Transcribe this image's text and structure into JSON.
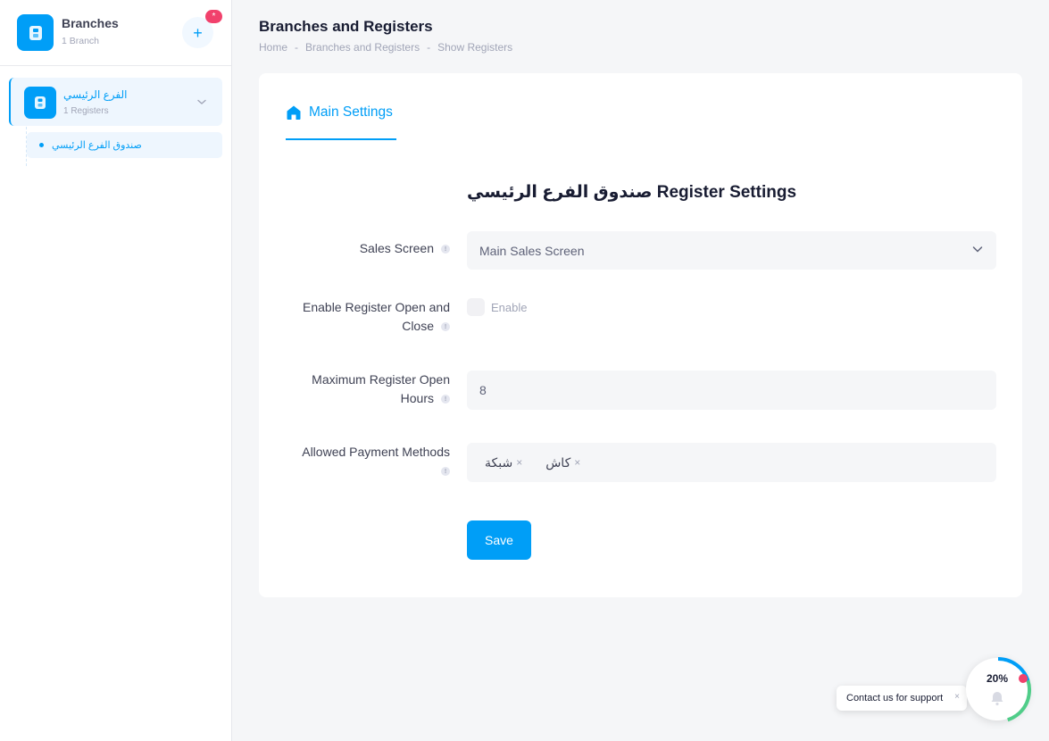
{
  "sidebar": {
    "title": "Branches",
    "subtitle": "1 Branch",
    "add_label": "+",
    "notif_badge": "*",
    "branch": {
      "name": "الفرع الرئيسي",
      "sub": "1 Registers",
      "registers": [
        {
          "name": "صندوق الفرع الرئيسي"
        }
      ]
    }
  },
  "header": {
    "title": "Branches and Registers",
    "breadcrumb": [
      "Home",
      "Branches and Registers",
      "Show Registers"
    ],
    "separator": "-"
  },
  "card": {
    "tab_label": "Main Settings",
    "section_title": "صندوق الفرع الرئيسي Register Settings",
    "info_glyph": "!",
    "fields": {
      "sales_screen": {
        "label": "Sales Screen",
        "value": "Main Sales Screen"
      },
      "open_close": {
        "label_line1": "Enable Register Open and",
        "label_line2": "Close",
        "checkbox_label": "Enable",
        "checked": false
      },
      "max_hours": {
        "label_line1": "Maximum Register Open",
        "label_line2": "Hours",
        "value": "8"
      },
      "payment_methods": {
        "label": "Allowed Payment Methods",
        "tags": [
          "شبكة",
          "كاش"
        ],
        "remove_glyph": "×"
      }
    },
    "save_label": "Save"
  },
  "support": {
    "label": "Contact us for support",
    "close_glyph": "×",
    "progress_text": "20%",
    "progress_fraction": 0.2
  },
  "colors": {
    "accent": "#009ef7",
    "danger": "#f1416c",
    "success": "#50cd89"
  }
}
